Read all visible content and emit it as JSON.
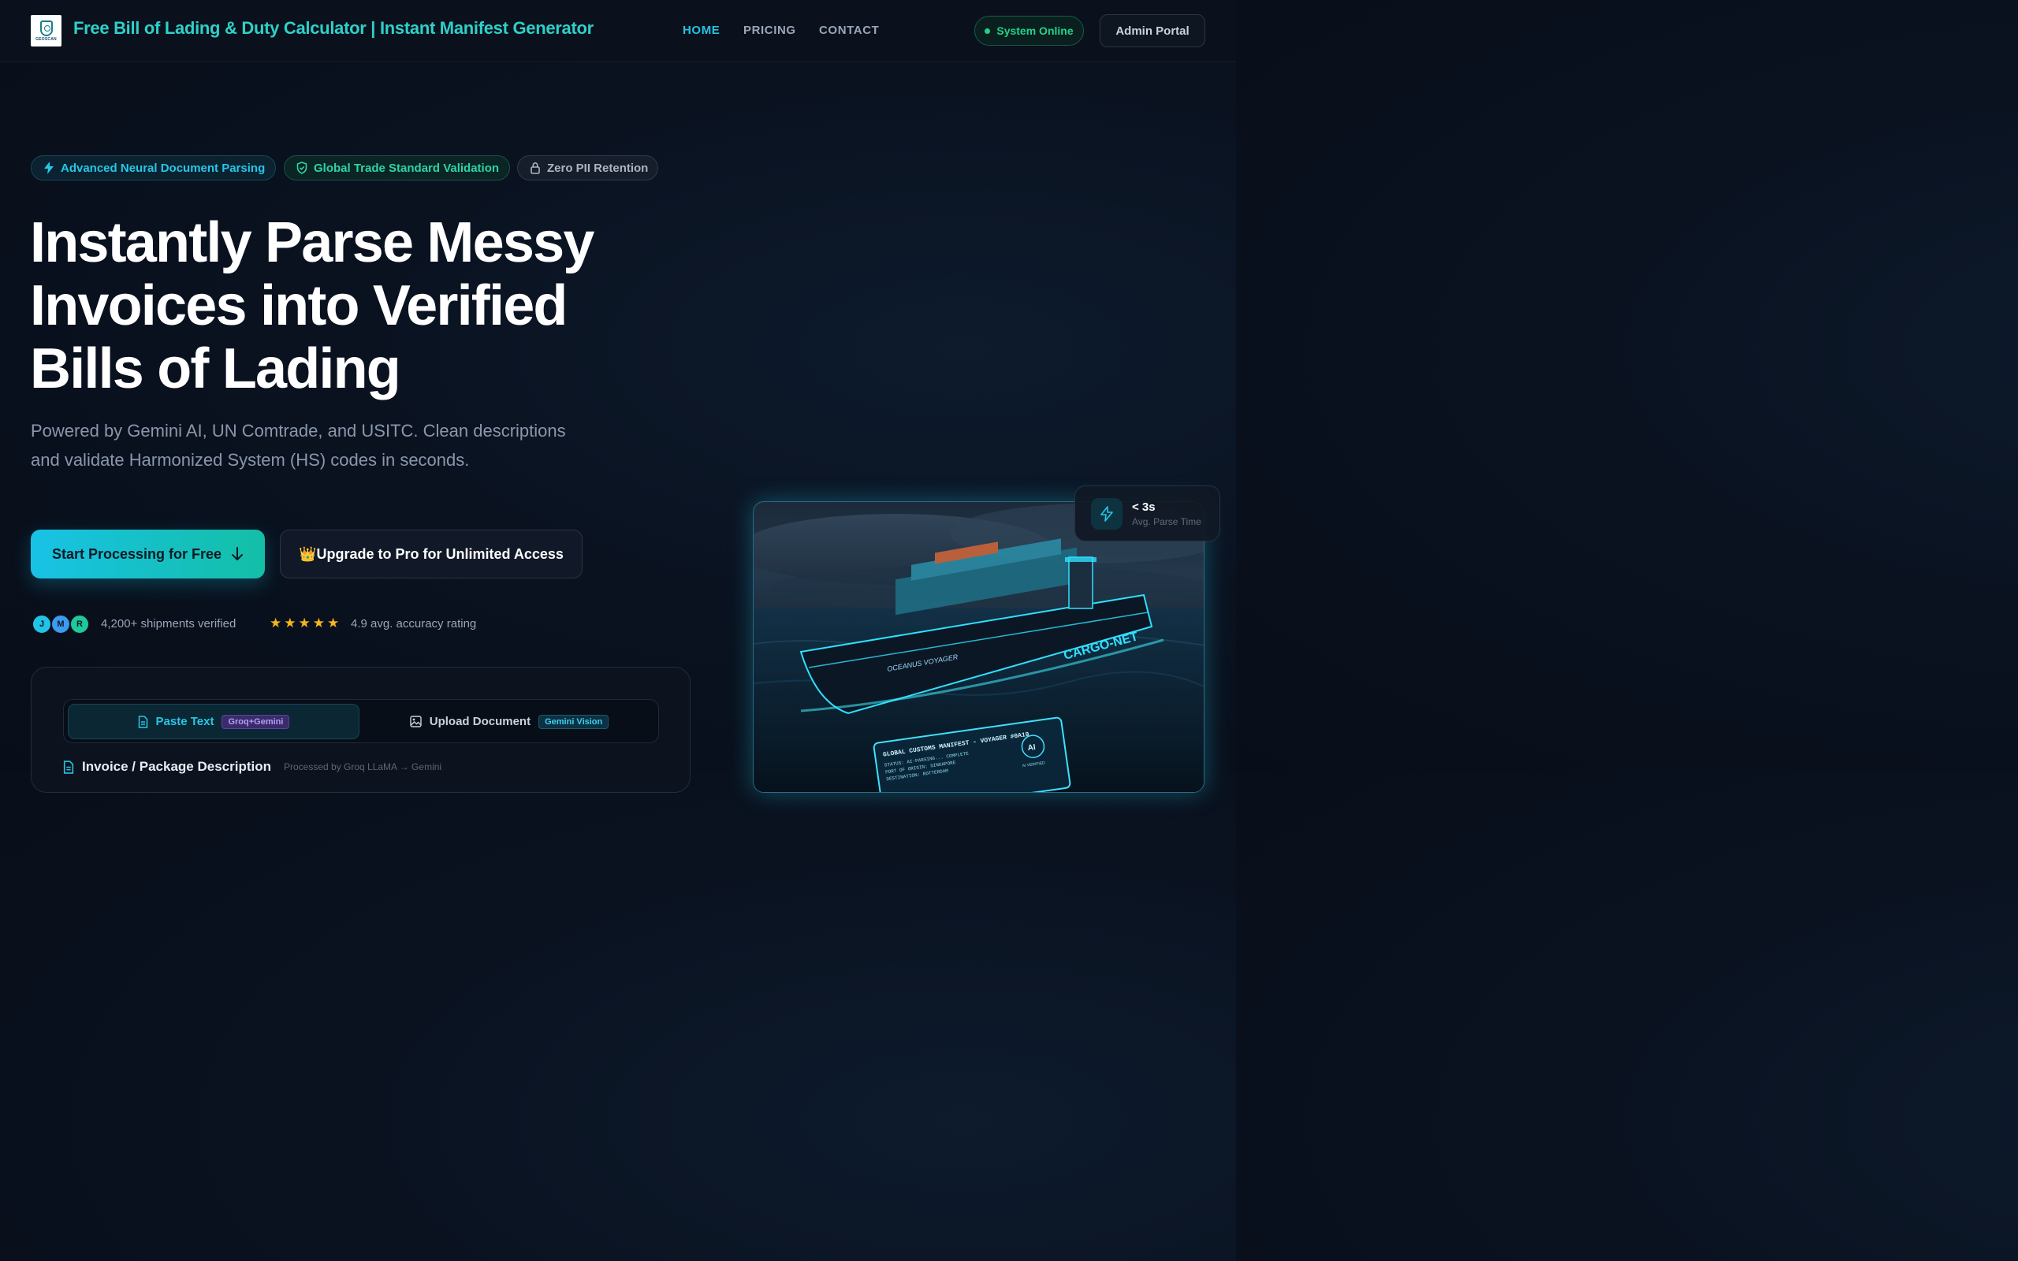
{
  "nav": {
    "logo_text": "GEOSCAN",
    "brand": "Free Bill of Lading & Duty Calculator | Instant Manifest Generator",
    "links": [
      {
        "label": "HOME",
        "active": true
      },
      {
        "label": "PRICING",
        "active": false
      },
      {
        "label": "CONTACT",
        "active": false
      }
    ],
    "status": "System Online",
    "admin": "Admin Portal"
  },
  "badges": [
    {
      "label": "Advanced Neural Document Parsing",
      "icon": "bolt-icon"
    },
    {
      "label": "Global Trade Standard Validation",
      "icon": "shield-check-icon"
    },
    {
      "label": "Zero PII Retention",
      "icon": "lock-icon"
    }
  ],
  "hero": {
    "title_lines": [
      "Instantly Parse Messy",
      "Invoices into Verified",
      "Bills of Lading"
    ],
    "subtitle": "Powered by Gemini AI, UN Comtrade, and USITC. Clean descriptions and validate Harmonized System (HS) codes in seconds.",
    "cta_primary": "Start Processing for Free",
    "cta_secondary": "👑Upgrade to Pro for Unlimited Access"
  },
  "social": {
    "avatars": [
      "J",
      "M",
      "R"
    ],
    "shipments": "4,200+ shipments verified",
    "stars": 5,
    "rating": "4.9 avg. accuracy rating"
  },
  "tool": {
    "tabs": [
      {
        "label": "Paste Text",
        "tag": "Groq+Gemini",
        "icon": "document-icon",
        "active": true
      },
      {
        "label": "Upload Document",
        "tag": "Gemini Vision",
        "icon": "image-icon",
        "active": false
      }
    ],
    "section_label": "Invoice / Package Description",
    "section_note": "Processed by Groq LLaMA → Gemini"
  },
  "stat": {
    "value": "< 3s",
    "label": "Avg. Parse Time"
  },
  "ship_image": {
    "hull_name": "OCEANUS VOYAGER",
    "hull_brand": "CARGO-NET",
    "manifest_title": "GLOBAL CUSTOMS MANIFEST - VOYAGER #0A19",
    "manifest_lines": [
      "STATUS: AI-PARSING... COMPLETE",
      "PORT OF ORIGIN: SINGAPORE",
      "DESTINATION: ROTTERDAM"
    ],
    "ai_badge": "AI",
    "ai_verified": "AI VERIFIED"
  },
  "colors": {
    "accent": "#25c3e0",
    "teal": "#2dd4a8",
    "online": "#22d38a",
    "star": "#f5b51c"
  }
}
